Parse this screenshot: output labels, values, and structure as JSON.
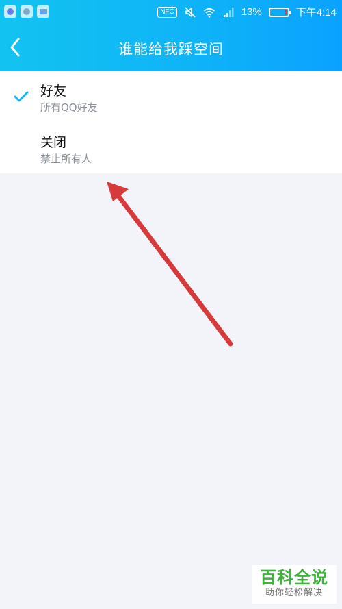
{
  "status_bar": {
    "nfc": "NFC",
    "battery_percent_text": "13%",
    "battery_level": 0.13,
    "time": "下午4:14",
    "icons": [
      "app-icon-1",
      "app-icon-2",
      "app-icon-3",
      "nfc-icon",
      "mute-icon",
      "wifi-icon",
      "signal-icon",
      "battery-icon"
    ]
  },
  "header": {
    "title": "谁能给我踩空间",
    "back_icon": "chevron-left-icon"
  },
  "options": [
    {
      "label": "好友",
      "sub": "所有QQ好友",
      "selected": true
    },
    {
      "label": "关闭",
      "sub": "禁止所有人",
      "selected": false
    }
  ],
  "colors": {
    "header_start": "#12c3f0",
    "header_end": "#0aa2ff",
    "check": "#12b7f5",
    "arrow": "#d63a3a",
    "page_bg": "#f3f4f9"
  },
  "watermark": {
    "main": "百科全说",
    "sub": "助你轻松解决"
  }
}
